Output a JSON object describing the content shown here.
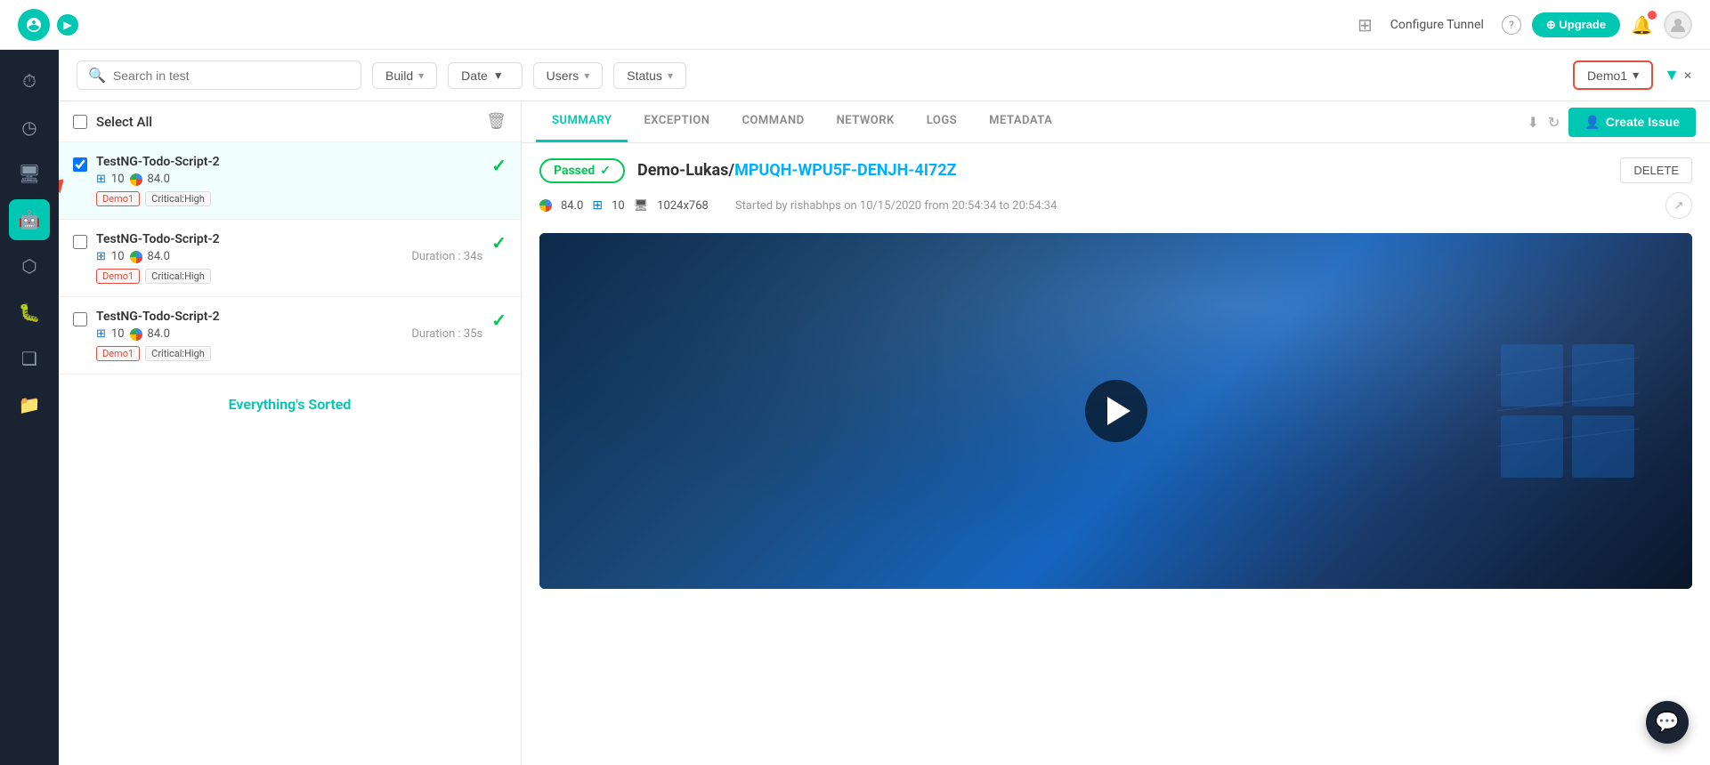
{
  "topnav": {
    "configure_tunnel": "Configure Tunnel",
    "upgrade_label": "⊕ Upgrade"
  },
  "filterbar": {
    "search_placeholder": "Search in test",
    "build_label": "Build",
    "date_label": "Date",
    "users_label": "Users",
    "status_label": "Status",
    "demo_label": "Demo1"
  },
  "test_list": {
    "select_all_label": "Select All",
    "items": [
      {
        "name": "TestNG-Todo-Script-2",
        "os_version": "10",
        "browser_version": "84.0",
        "duration": "",
        "tags": [
          "Demo1",
          "Critical:High"
        ],
        "passed": true,
        "selected": true
      },
      {
        "name": "TestNG-Todo-Script-2",
        "os_version": "10",
        "browser_version": "84.0",
        "duration": "Duration : 34s",
        "tags": [
          "Demo1",
          "Critical:High"
        ],
        "passed": true,
        "selected": false
      },
      {
        "name": "TestNG-Todo-Script-2",
        "os_version": "10",
        "browser_version": "84.0",
        "duration": "Duration : 35s",
        "tags": [
          "Demo1",
          "Critical:High"
        ],
        "passed": true,
        "selected": false
      }
    ],
    "everything_sorted": "Everything's Sorted"
  },
  "detail_tabs": {
    "tabs": [
      {
        "id": "summary",
        "label": "SUMMARY",
        "active": true
      },
      {
        "id": "exception",
        "label": "EXCEPTION",
        "active": false
      },
      {
        "id": "command",
        "label": "COMMAND",
        "active": false
      },
      {
        "id": "network",
        "label": "NETWORK",
        "active": false
      },
      {
        "id": "logs",
        "label": "LOGS",
        "active": false
      },
      {
        "id": "metadata",
        "label": "METADATA",
        "active": false
      }
    ],
    "create_issue_label": "Create Issue"
  },
  "test_detail": {
    "status": "Passed",
    "status_check": "✓",
    "test_project": "Demo-Lukas/",
    "test_id": "MPUQH-WPU5F-DENJH-4I72Z",
    "delete_label": "DELETE",
    "browser_version": "84.0",
    "os_version": "10",
    "resolution": "1024x768",
    "started_by": "Started by rishabhps on 10/15/2020 from 20:54:34 to 20:54:34"
  },
  "icons": {
    "search": "🔍",
    "grid": "⊞",
    "help": "?",
    "bell": "🔔",
    "chevron_down": "▾",
    "delete": "🗑",
    "filter": "⊞",
    "download": "⬇",
    "refresh": "↻",
    "create_issue": "👤",
    "chat": "💬",
    "share": "↗"
  },
  "sidebar_items": [
    {
      "id": "analytics",
      "icon": "⏱",
      "active": false
    },
    {
      "id": "history",
      "icon": "🕐",
      "active": false
    },
    {
      "id": "monitor",
      "icon": "🖥",
      "active": false
    },
    {
      "id": "robot",
      "icon": "🤖",
      "active": true
    },
    {
      "id": "cube",
      "icon": "📦",
      "active": false
    },
    {
      "id": "bug",
      "icon": "🐛",
      "active": false
    },
    {
      "id": "layers",
      "icon": "◫",
      "active": false
    },
    {
      "id": "folder",
      "icon": "📁",
      "active": false
    }
  ]
}
